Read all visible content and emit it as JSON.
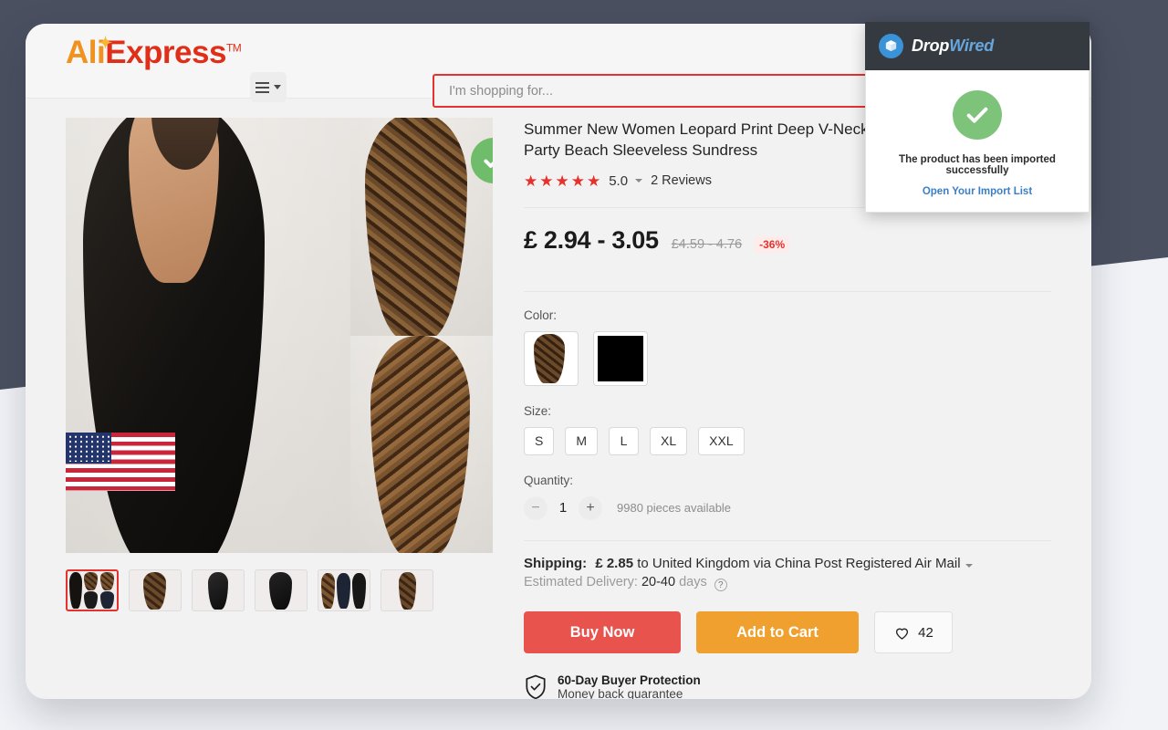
{
  "header": {
    "logo_ali": "Ali",
    "logo_express": "Express",
    "logo_tm": "TM",
    "menu_icon": "hamburger-menu-icon",
    "search_placeholder": "I'm shopping for...",
    "search_value": ""
  },
  "gallery": {
    "imported_badge_icon": "check-circle-icon",
    "flag_label": "United States flag overlay",
    "thumbnails": [
      {
        "label": "thumbnail-1",
        "selected": true
      },
      {
        "label": "thumbnail-2",
        "selected": false
      },
      {
        "label": "thumbnail-3",
        "selected": false
      },
      {
        "label": "thumbnail-4",
        "selected": false
      },
      {
        "label": "thumbnail-5",
        "selected": false
      },
      {
        "label": "thumbnail-6",
        "selected": false
      }
    ]
  },
  "product": {
    "title": "Summer New Women Leopard Print Deep V-Neck Long Maxi Dress Evening Party Beach Sleeveless Sundress",
    "stars": "★★★★★",
    "score": "5.0",
    "reviews": "2 Reviews",
    "price_current": "£ 2.94 - 3.05",
    "price_original": "£4.59 - 4.76",
    "discount": "-36%",
    "color_label": "Color:",
    "colors": [
      "leopard-print",
      "black"
    ],
    "size_label": "Size:",
    "sizes": [
      "S",
      "M",
      "L",
      "XL",
      "XXL"
    ],
    "quantity_label": "Quantity:",
    "quantity_value": "1",
    "quantity_minus": "−",
    "quantity_plus": "+",
    "stock_text": "9980 pieces available",
    "shipping_label": "Shipping:",
    "shipping_price": "£ 2.85",
    "shipping_rest": "to United Kingdom via China Post Registered Air Mail",
    "eta_label": "Estimated Delivery:",
    "eta_value": "20-40",
    "eta_unit": "days",
    "eta_help": "?",
    "buy_now": "Buy Now",
    "add_to_cart": "Add to Cart",
    "wishlist_count": "42",
    "wishlist_icon": "heart-icon",
    "guarantee_icon": "shield-check-icon",
    "guarantee_title": "60-Day Buyer Protection",
    "guarantee_sub": "Money back guarantee"
  },
  "popup": {
    "brand_drop": "Drop",
    "brand_wired": "Wired",
    "brand_icon": "package-box-icon",
    "success_icon": "check-icon",
    "message": "The product has been imported successfully",
    "link": "Open Your Import List"
  },
  "colors": {
    "backdrop": "#4a5060",
    "page": "#f1f3f7",
    "accent_red": "#e4322e",
    "buy_now": "#e9534e",
    "add_to_cart": "#f0a02f",
    "success_green": "#7ec37a",
    "popup_header": "#343a40",
    "link_blue": "#3b7fc4"
  }
}
